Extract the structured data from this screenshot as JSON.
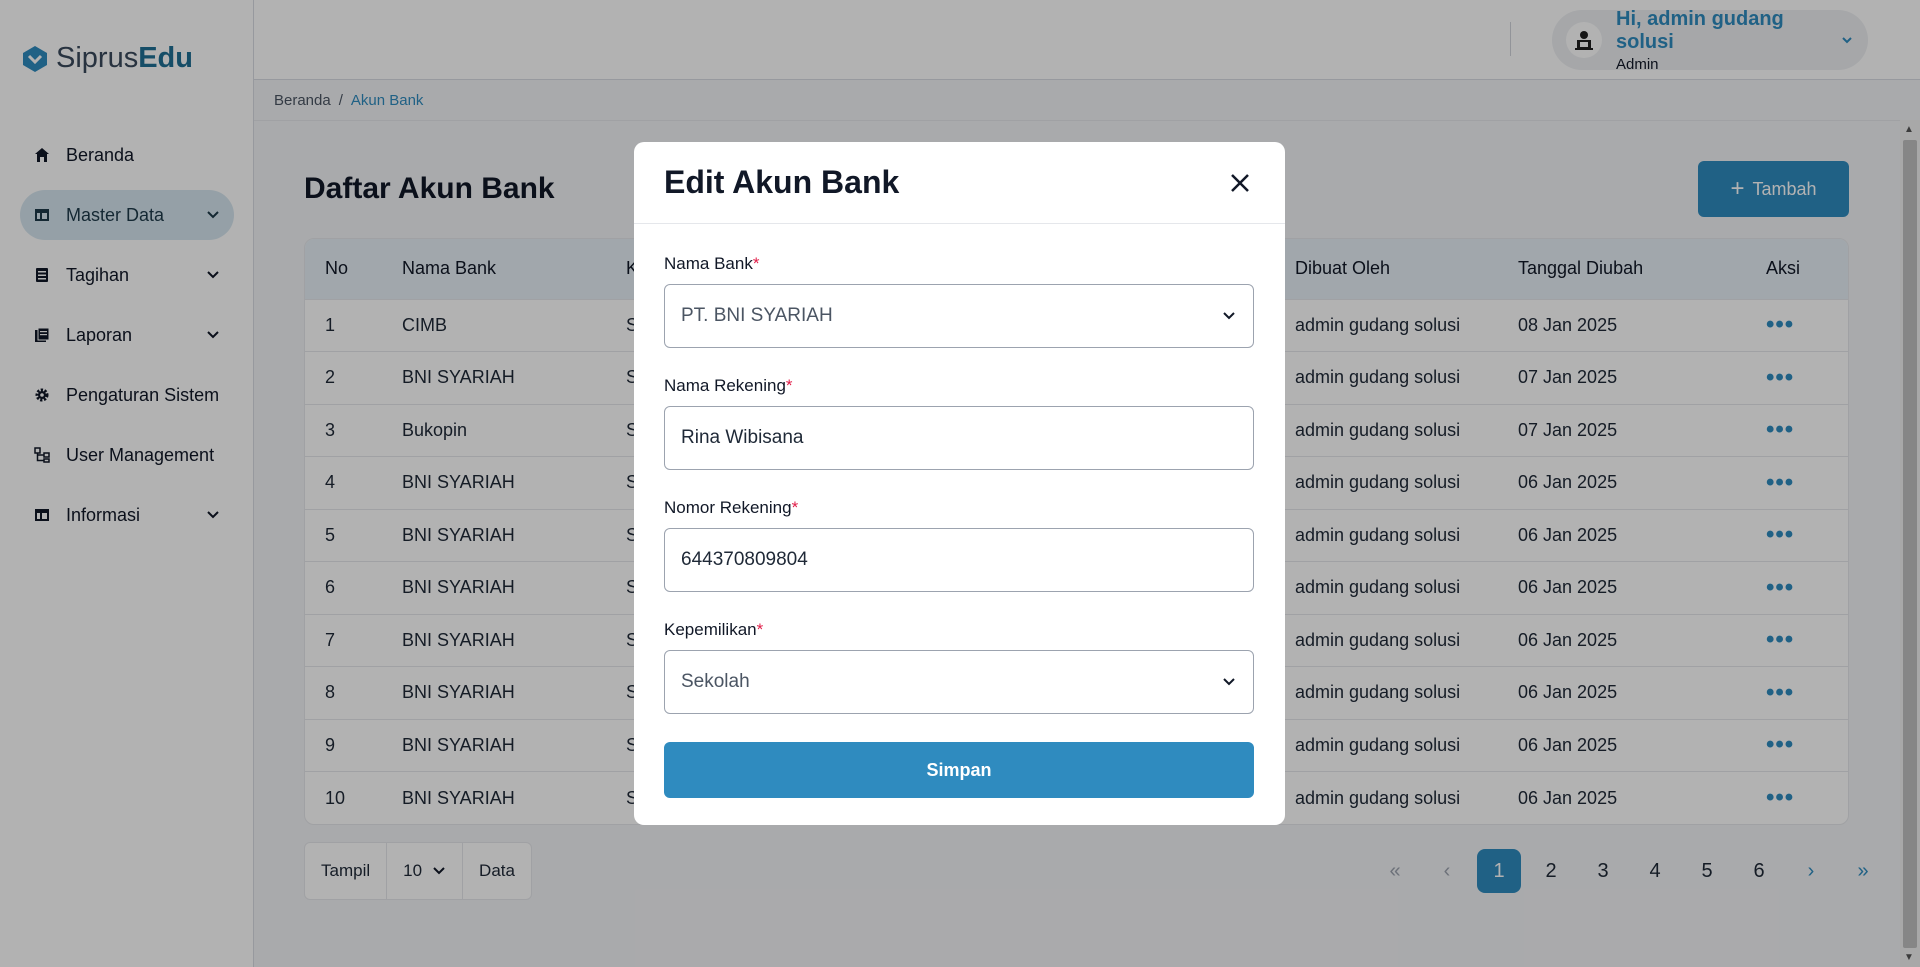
{
  "brand": {
    "name_part1": "Siprus",
    "name_part2": "Edu"
  },
  "sidebar": {
    "items": [
      {
        "label": "Beranda"
      },
      {
        "label": "Master Data"
      },
      {
        "label": "Tagihan"
      },
      {
        "label": "Laporan"
      },
      {
        "label": "Pengaturan Sistem"
      },
      {
        "label": "User Management"
      },
      {
        "label": "Informasi"
      }
    ]
  },
  "header": {
    "greeting": "Hi, admin gudang solusi",
    "role": "Admin"
  },
  "breadcrumb": {
    "home": "Beranda",
    "separator": "/",
    "current": "Akun Bank"
  },
  "page": {
    "title": "Daftar Akun Bank",
    "add_button": "Tambah"
  },
  "table": {
    "columns": [
      "No",
      "Nama Bank",
      "K",
      "Dibuat Oleh",
      "Tanggal Diubah",
      "Aksi"
    ],
    "rows": [
      {
        "no": "1",
        "bank": "CIMB",
        "k": "S",
        "created_by": "admin gudang solusi",
        "updated": "08 Jan 2025"
      },
      {
        "no": "2",
        "bank": "BNI SYARIAH",
        "k": "S",
        "created_by": "admin gudang solusi",
        "updated": "07 Jan 2025"
      },
      {
        "no": "3",
        "bank": "Bukopin",
        "k": "S",
        "created_by": "admin gudang solusi",
        "updated": "07 Jan 2025"
      },
      {
        "no": "4",
        "bank": "BNI SYARIAH",
        "k": "S",
        "created_by": "admin gudang solusi",
        "updated": "06 Jan 2025"
      },
      {
        "no": "5",
        "bank": "BNI SYARIAH",
        "k": "S",
        "created_by": "admin gudang solusi",
        "updated": "06 Jan 2025"
      },
      {
        "no": "6",
        "bank": "BNI SYARIAH",
        "k": "S",
        "created_by": "admin gudang solusi",
        "updated": "06 Jan 2025"
      },
      {
        "no": "7",
        "bank": "BNI SYARIAH",
        "k": "S",
        "created_by": "admin gudang solusi",
        "updated": "06 Jan 2025"
      },
      {
        "no": "8",
        "bank": "BNI SYARIAH",
        "k": "S",
        "created_by": "admin gudang solusi",
        "updated": "06 Jan 2025"
      },
      {
        "no": "9",
        "bank": "BNI SYARIAH",
        "k": "S",
        "created_by": "admin gudang solusi",
        "updated": "06 Jan 2025"
      },
      {
        "no": "10",
        "bank": "BNI SYARIAH",
        "k": "S",
        "created_by": "admin gudang solusi",
        "updated": "06 Jan 2025"
      }
    ],
    "action_glyph": "•••"
  },
  "footer": {
    "show_label": "Tampil",
    "per_page": "10",
    "data_label": "Data",
    "pages": [
      "1",
      "2",
      "3",
      "4",
      "5",
      "6"
    ],
    "current_page": "1",
    "first": "«",
    "prev": "‹",
    "next": "›",
    "last": "»"
  },
  "modal": {
    "title": "Edit Akun Bank",
    "fields": {
      "nama_bank": {
        "label": "Nama Bank",
        "value": "PT. BNI SYARIAH"
      },
      "nama_rekening": {
        "label": "Nama Rekening",
        "value": "Rina Wibisana"
      },
      "nomor_rekening": {
        "label": "Nomor Rekening",
        "value": "644370809804"
      },
      "kepemilikan": {
        "label": "Kepemilikan",
        "value": "Sekolah"
      }
    },
    "required_mark": "*",
    "save_button": "Simpan"
  },
  "colors": {
    "accent": "#2f8bbf",
    "required": "#e11d48"
  }
}
